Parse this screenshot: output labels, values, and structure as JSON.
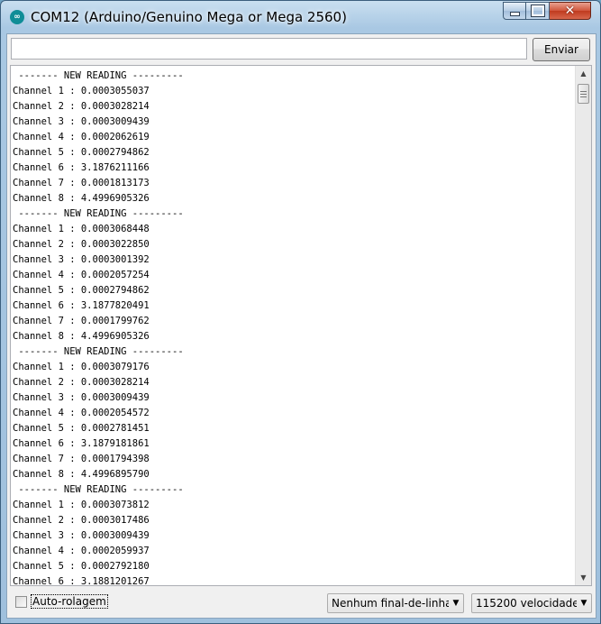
{
  "window": {
    "title": "COM12 (Arduino/Genuino Mega or Mega 2560)",
    "icon": "arduino-icon",
    "controls": {
      "minimize": "minimize-icon",
      "maximize": "maximize-icon",
      "close": "close-icon"
    }
  },
  "toolbar": {
    "input_value": "",
    "send_label": "Enviar"
  },
  "output": {
    "lines": [
      " ------- NEW READING ---------",
      "Channel 1 : 0.0003055037",
      "Channel 2 : 0.0003028214",
      "Channel 3 : 0.0003009439",
      "Channel 4 : 0.0002062619",
      "Channel 5 : 0.0002794862",
      "Channel 6 : 3.1876211166",
      "Channel 7 : 0.0001813173",
      "Channel 8 : 4.4996905326",
      " ------- NEW READING ---------",
      "Channel 1 : 0.0003068448",
      "Channel 2 : 0.0003022850",
      "Channel 3 : 0.0003001392",
      "Channel 4 : 0.0002057254",
      "Channel 5 : 0.0002794862",
      "Channel 6 : 3.1877820491",
      "Channel 7 : 0.0001799762",
      "Channel 8 : 4.4996905326",
      " ------- NEW READING ---------",
      "Channel 1 : 0.0003079176",
      "Channel 2 : 0.0003028214",
      "Channel 3 : 0.0003009439",
      "Channel 4 : 0.0002054572",
      "Channel 5 : 0.0002781451",
      "Channel 6 : 3.1879181861",
      "Channel 7 : 0.0001794398",
      "Channel 8 : 4.4996895790",
      " ------- NEW READING ---------",
      "Channel 1 : 0.0003073812",
      "Channel 2 : 0.0003017486",
      "Channel 3 : 0.0003009439",
      "Channel 4 : 0.0002059937",
      "Channel 5 : 0.0002792180",
      "Channel 6 : 3.1881201267"
    ]
  },
  "footer": {
    "autoscroll_label": "Auto-rolagem",
    "autoscroll_checked": false,
    "line_ending_value": "Nenhum final-de-linha",
    "baud_value": "115200 velocidade"
  },
  "colors": {
    "frame": "#a9c8e3",
    "close_button": "#c94a2e"
  }
}
